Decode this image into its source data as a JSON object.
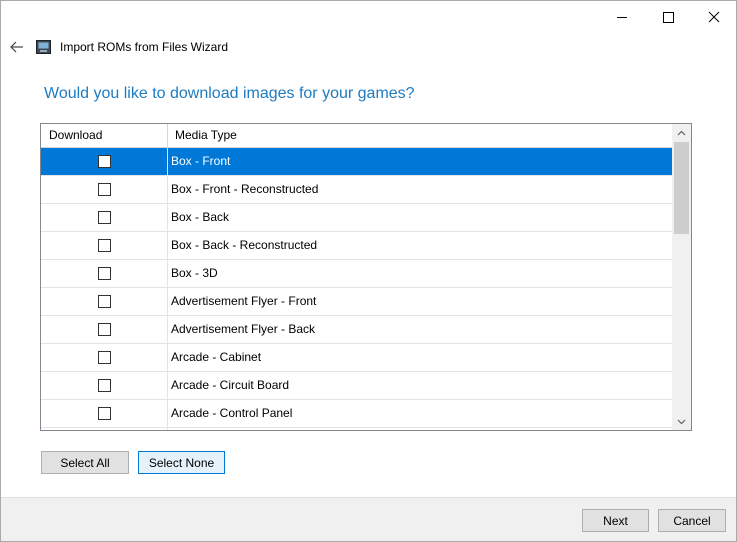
{
  "window": {
    "title": "Import ROMs from Files Wizard",
    "accent_color": "#0078d7",
    "heading_color": "#1e7bc0"
  },
  "page": {
    "question": "Would you like to download images for your games?"
  },
  "grid": {
    "columns": [
      "Download",
      "Media Type"
    ],
    "rows": [
      {
        "download": false,
        "media_type": "Box - Front",
        "selected": true
      },
      {
        "download": false,
        "media_type": "Box - Front - Reconstructed"
      },
      {
        "download": false,
        "media_type": "Box - Back"
      },
      {
        "download": false,
        "media_type": "Box - Back - Reconstructed"
      },
      {
        "download": false,
        "media_type": "Box - 3D"
      },
      {
        "download": false,
        "media_type": "Advertisement Flyer - Front"
      },
      {
        "download": false,
        "media_type": "Advertisement Flyer - Back"
      },
      {
        "download": false,
        "media_type": "Arcade - Cabinet"
      },
      {
        "download": false,
        "media_type": "Arcade - Circuit Board"
      },
      {
        "download": false,
        "media_type": "Arcade - Control Panel"
      },
      {
        "download": false,
        "media_type": ""
      }
    ]
  },
  "buttons": {
    "select_all": "Select All",
    "select_none": "Select None",
    "next": "Next",
    "cancel": "Cancel"
  },
  "icons": {
    "back": "back-arrow-icon",
    "app": "launchbox-app-icon",
    "minimize": "minimize-icon",
    "maximize": "maximize-icon",
    "close": "close-icon",
    "scroll_up": "chevron-up-icon",
    "scroll_down": "chevron-down-icon",
    "checkbox": "checkbox-icon"
  }
}
